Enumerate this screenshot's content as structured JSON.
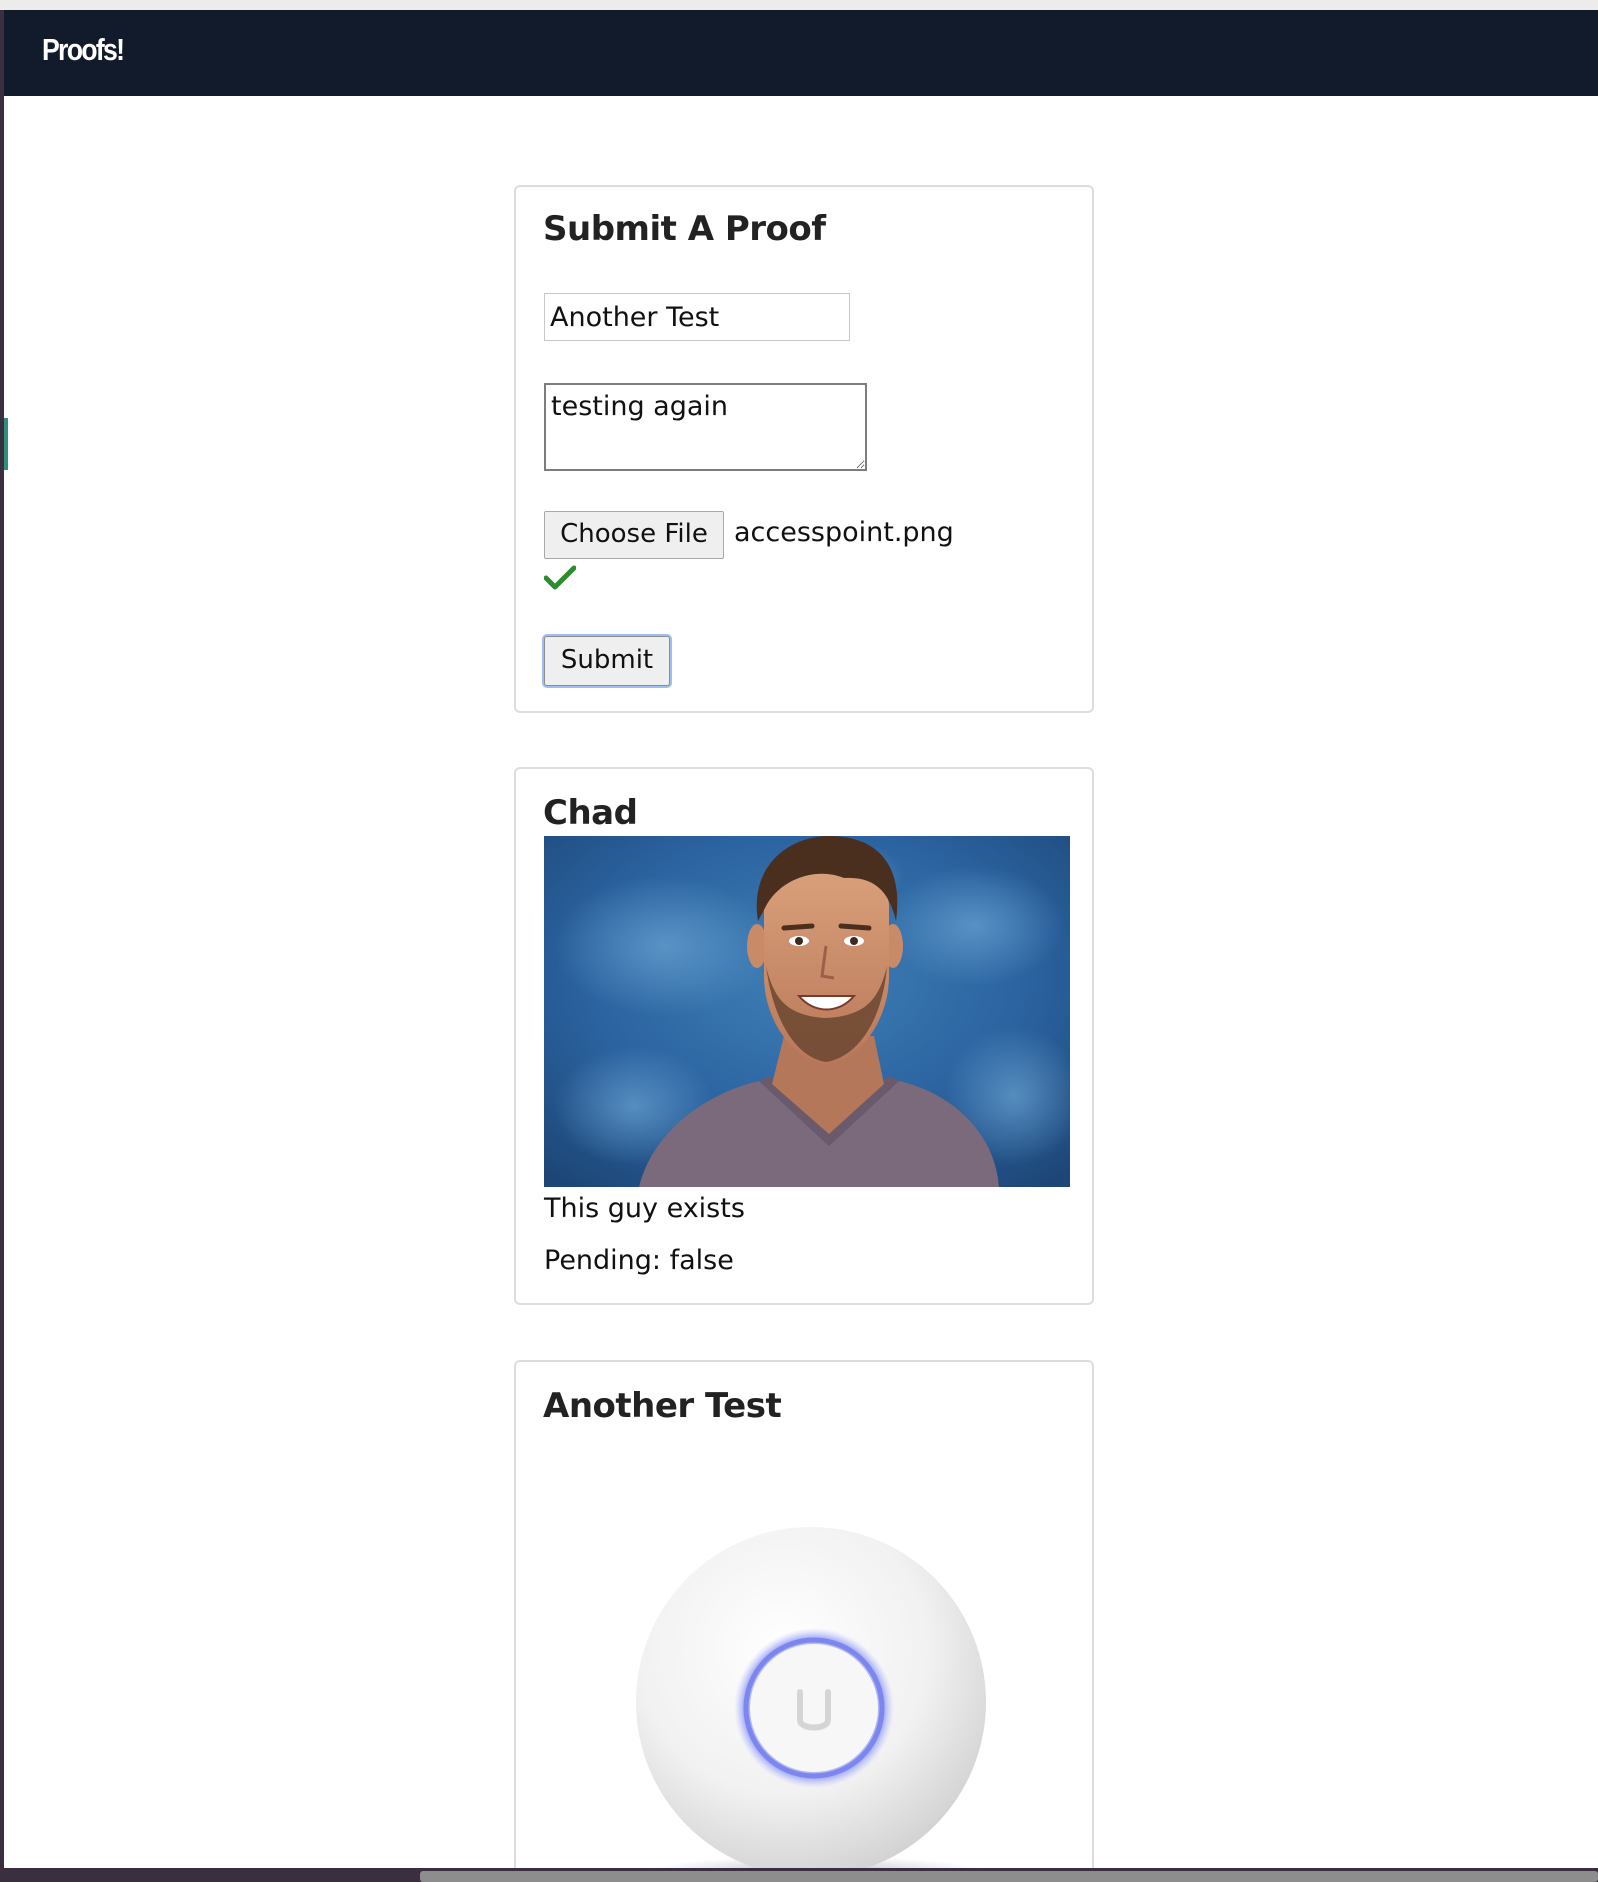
{
  "navbar": {
    "brand": "Proofs!"
  },
  "submit_form": {
    "heading": "Submit A Proof",
    "title_value": "Another Test",
    "description_value": "testing again",
    "choose_file_label": "Choose File",
    "file_name": "accesspoint.png",
    "submit_label": "Submit"
  },
  "proofs": [
    {
      "title": "Chad",
      "image_icon": "portrait-photo",
      "description": "This guy exists",
      "pending_label": "Pending:",
      "pending_value": "false"
    },
    {
      "title": "Another Test",
      "image_icon": "access-point-photo"
    }
  ],
  "colors": {
    "navbar_bg": "#121b2c",
    "card_border": "#dddddd",
    "check_green": "#2e8b2e",
    "focus_ring": "#9fbef0"
  }
}
